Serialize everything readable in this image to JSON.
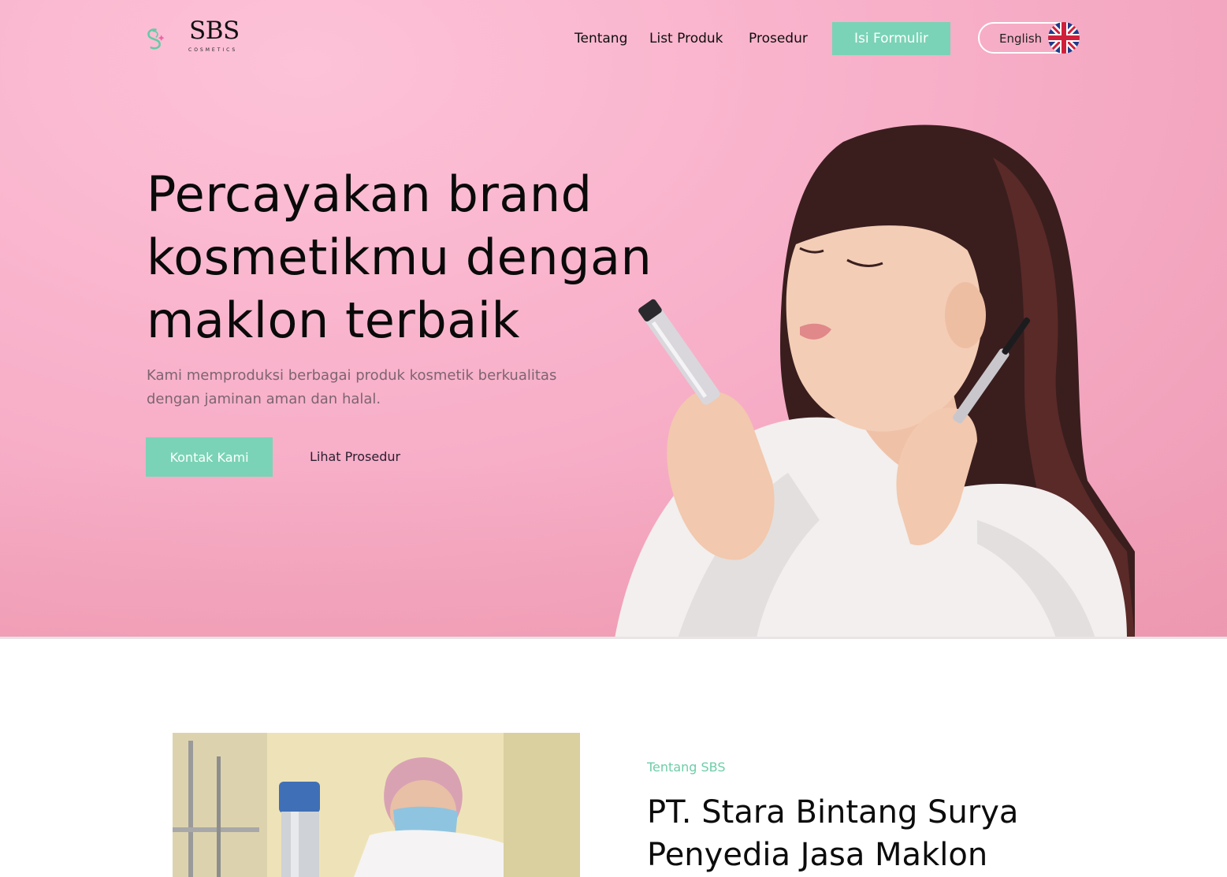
{
  "brand": {
    "name": "SBS",
    "tagline": "COSMETICS"
  },
  "nav": {
    "items": [
      "Tentang",
      "List Produk",
      "Prosedur"
    ],
    "cta_label": "Isi Formulir",
    "language_label": "English"
  },
  "hero": {
    "headline_lines": [
      "Percayakan brand",
      "kosmetikmu dengan",
      "maklon terbaik"
    ],
    "subtitle_lines": [
      "Kami memproduksi berbagai produk kosmetik berkualitas",
      "dengan jaminan aman dan halal."
    ],
    "primary_button": "Kontak Kami",
    "secondary_button": "Lihat Prosedur"
  },
  "about": {
    "eyebrow": "Tentang SBS",
    "title_lines": [
      "PT. Stara Bintang Surya",
      "Penyedia Jasa Maklon"
    ]
  },
  "colors": {
    "accent": "#7ad3b6",
    "hero_pink": "#f8b0c9",
    "text_dark": "#0a0a0a",
    "subtitle": "#7d6470"
  },
  "icons": {
    "language_flag": "uk-flag-icon",
    "logo": "sbs-logo-icon"
  }
}
